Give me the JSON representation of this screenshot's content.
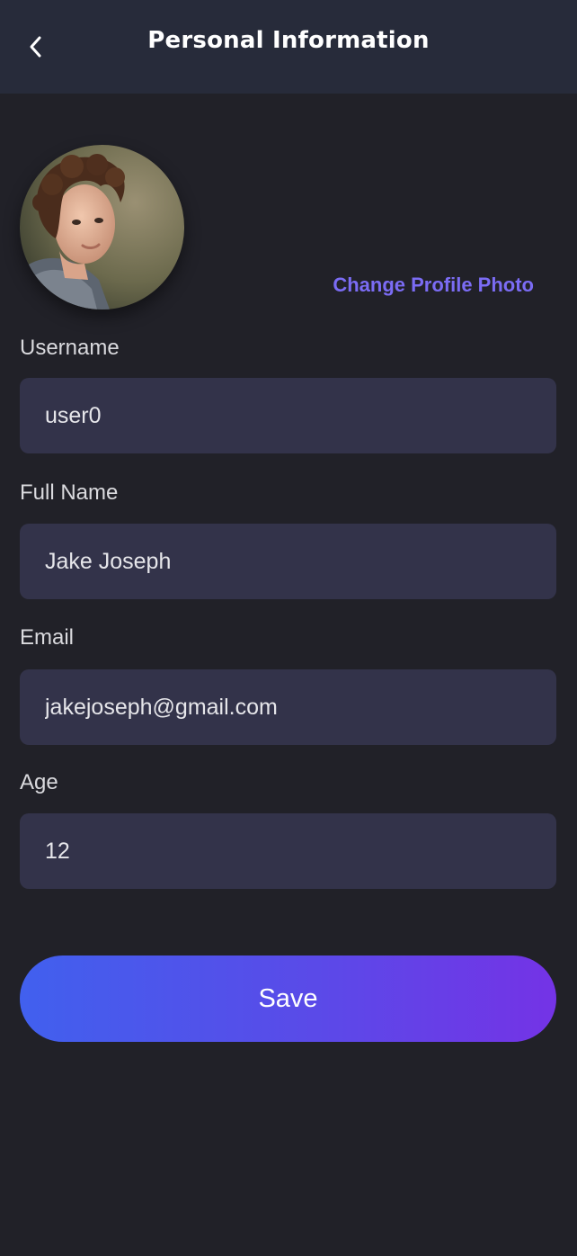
{
  "header": {
    "title": "Personal Information",
    "back_icon": "chevron-left-icon"
  },
  "profile": {
    "avatar_description": "avatar",
    "change_photo_label": "Change Profile Photo",
    "accent_color": "#7b6cf4"
  },
  "form": {
    "fields": [
      {
        "label": "Username",
        "value": "user0"
      },
      {
        "label": "Full Name",
        "value": "Jake Joseph"
      },
      {
        "label": "Email",
        "value": "jakejoseph@gmail.com"
      },
      {
        "label": "Age",
        "value": "12"
      }
    ]
  },
  "actions": {
    "save_label": "Save",
    "save_gradient": [
      "#4160ee",
      "#7433e6"
    ]
  },
  "colors": {
    "background": "#212128",
    "header": "#272b3a",
    "input": "#33334a"
  }
}
